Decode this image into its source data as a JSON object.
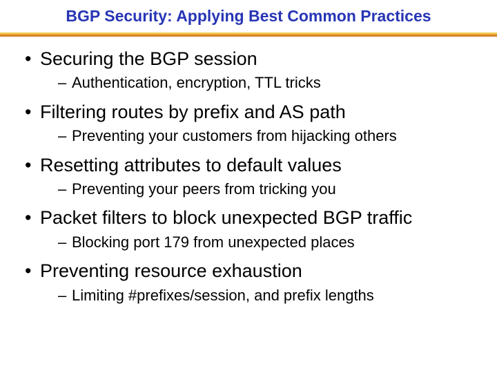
{
  "title": "BGP Security: Applying Best Common Practices",
  "bullets": [
    {
      "text": "Securing the BGP session",
      "sub": [
        "Authentication, encryption, TTL tricks"
      ]
    },
    {
      "text": "Filtering routes by prefix and AS path",
      "sub": [
        "Preventing your customers from hijacking others"
      ]
    },
    {
      "text": "Resetting attributes to default values",
      "sub": [
        "Preventing your peers from tricking you"
      ]
    },
    {
      "text": "Packet filters to block unexpected BGP traffic",
      "sub": [
        "Blocking port 179 from unexpected places"
      ]
    },
    {
      "text": "Preventing resource exhaustion",
      "sub": [
        "Limiting #prefixes/session, and prefix lengths"
      ]
    }
  ]
}
